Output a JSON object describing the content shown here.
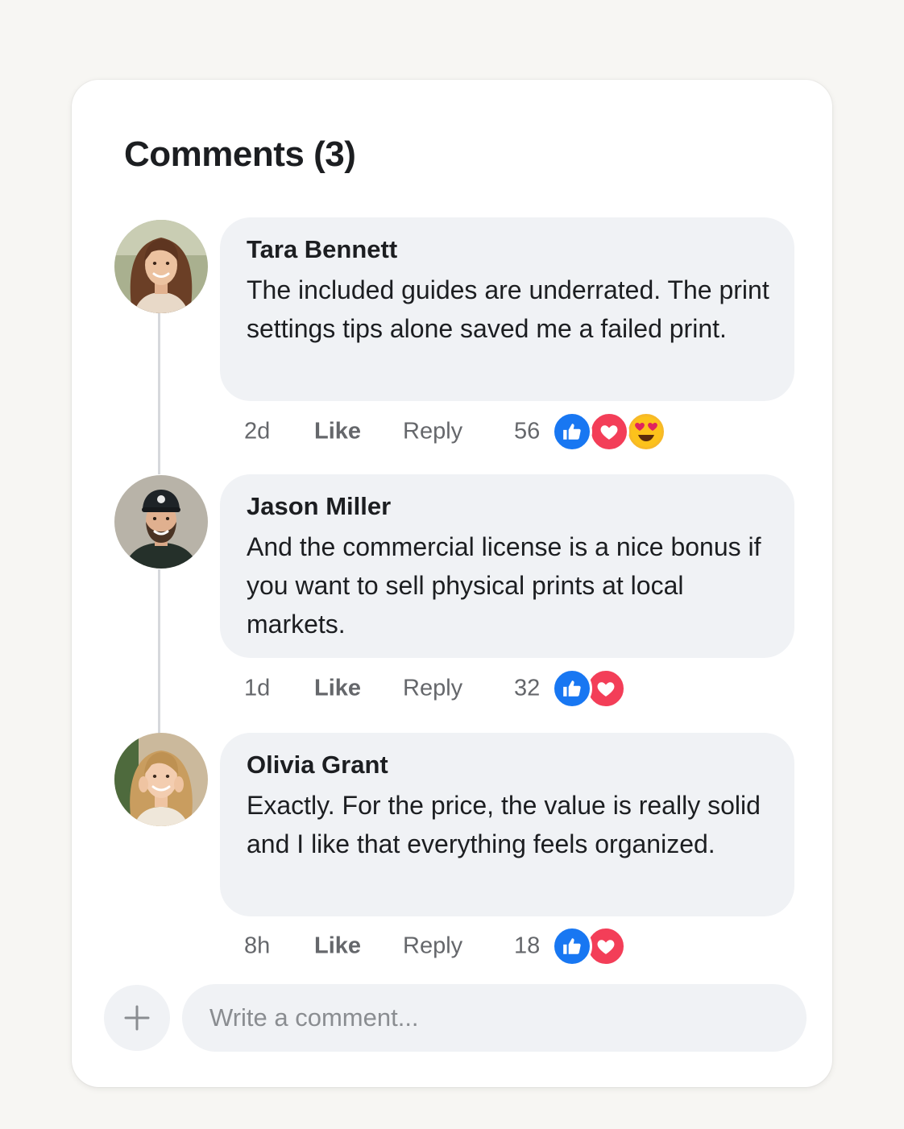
{
  "header": {
    "title": "Comments (3)"
  },
  "comments": [
    {
      "author": "Tara Bennett",
      "text": "The included guides are underrated. The print settings tips alone saved me a failed print.",
      "time": "2d",
      "like_label": "Like",
      "reply_label": "Reply",
      "reaction_count": "56",
      "reactions": [
        "like-icon",
        "love-icon",
        "heart-eyes-emoji-icon"
      ]
    },
    {
      "author": "Jason Miller",
      "text": "And the commercial license is a nice bonus if you want to sell physical prints at local markets.",
      "time": "1d",
      "like_label": "Like",
      "reply_label": "Reply",
      "reaction_count": "32",
      "reactions": [
        "like-icon",
        "love-icon"
      ]
    },
    {
      "author": "Olivia Grant",
      "text": "Exactly. For the price, the value is really solid and I like that everything feels organized.",
      "time": "8h",
      "like_label": "Like",
      "reply_label": "Reply",
      "reaction_count": "18",
      "reactions": [
        "like-icon",
        "love-icon"
      ]
    }
  ],
  "composer": {
    "placeholder": "Write a comment...",
    "value": "",
    "add_icon": "plus-icon"
  },
  "colors": {
    "like_blue": "#1877f2",
    "love_red": "#f33e58",
    "bubble_bg": "#f0f2f5",
    "text_primary": "#1c1e21",
    "text_secondary": "#65676b"
  }
}
